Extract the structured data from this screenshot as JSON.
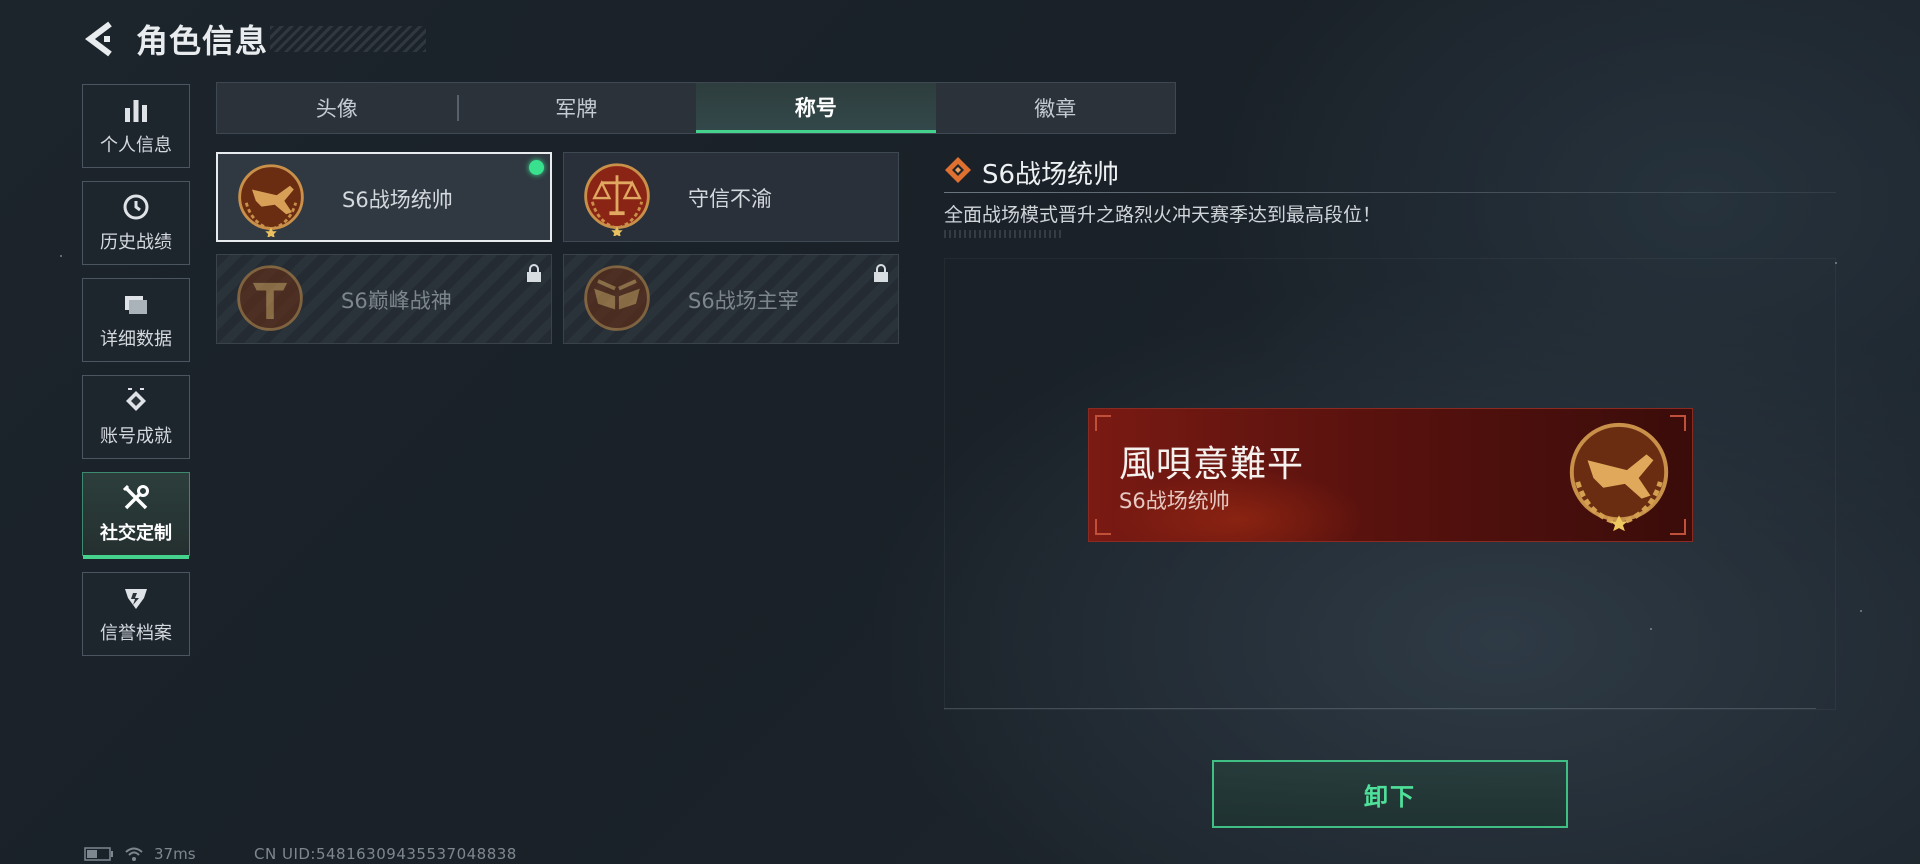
{
  "header": {
    "title": "角色信息"
  },
  "sidebar": {
    "items": [
      {
        "label": "个人信息",
        "icon": "bar-chart-icon"
      },
      {
        "label": "历史战绩",
        "icon": "history-icon"
      },
      {
        "label": "详细数据",
        "icon": "folder-icon"
      },
      {
        "label": "账号成就",
        "icon": "achievement-icon"
      },
      {
        "label": "社交定制",
        "icon": "tools-icon",
        "active": true
      },
      {
        "label": "信誉档案",
        "icon": "shield-icon"
      }
    ]
  },
  "tabs": [
    {
      "label": "头像"
    },
    {
      "label": "军牌"
    },
    {
      "label": "称号",
      "active": true
    },
    {
      "label": "徽章"
    }
  ],
  "titles": [
    {
      "name": "S6战场统帅",
      "selected": true,
      "equipped": true,
      "locked": false,
      "emblem": "jet-emblem-icon"
    },
    {
      "name": "守信不渝",
      "selected": false,
      "equipped": false,
      "locked": false,
      "emblem": "scales-emblem-icon"
    },
    {
      "name": "S6巅峰战神",
      "selected": false,
      "equipped": false,
      "locked": true,
      "emblem": "t-emblem-icon"
    },
    {
      "name": "S6战场主宰",
      "selected": false,
      "equipped": false,
      "locked": true,
      "emblem": "wings-emblem-icon"
    }
  ],
  "detail": {
    "title": "S6战场统帅",
    "description": "全面战场模式晋升之路烈火冲天赛季达到最高段位！"
  },
  "nameplate": {
    "nickname": "風唄意難平",
    "title": "S6战场统帅"
  },
  "actions": {
    "unequip_label": "卸下"
  },
  "status": {
    "ping": "37ms",
    "uid": "CN UID:5481630943553704883​8"
  },
  "colors": {
    "accent_green": "#45d28d",
    "plate_red": "#7a1a13",
    "emblem_gold": "#c9904a"
  }
}
